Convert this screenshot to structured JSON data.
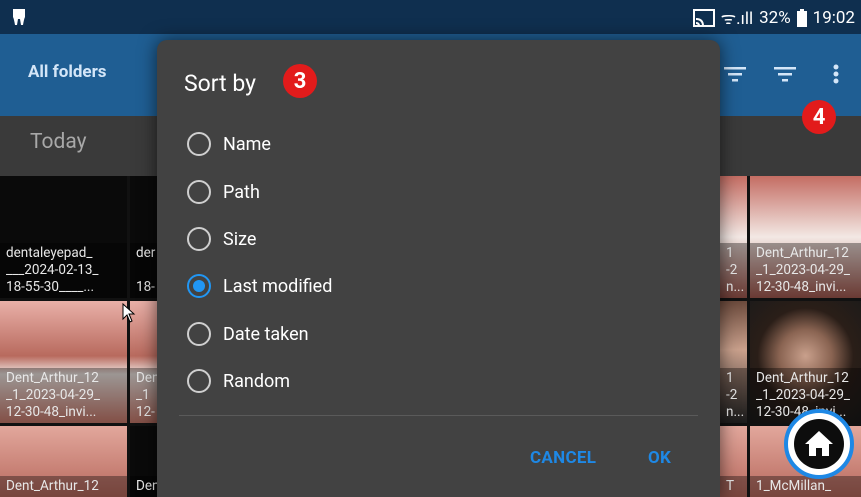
{
  "status": {
    "signal": "ᯤ.ıll",
    "battery": "32%",
    "time": "19:02"
  },
  "appbar": {
    "title": "All folders"
  },
  "subheader": {
    "label": "Today"
  },
  "tiles": [
    {
      "caption": "dentaleyepad_\n___2024-02-13_\n18-55-30____..."
    },
    {
      "caption": "der\n\n18-"
    },
    {
      "caption": "Dent_Arthur_12\n_1_2023-04-29_\n12-30-48_invi..."
    },
    {
      "caption": "Den\n_1\n12-"
    },
    {
      "caption": "1\n-2\nn..."
    },
    {
      "caption": "Dent_Arthur_12\n_1_2023-04-29_\n12-30-48_invi..."
    },
    {
      "caption": "1\n-2\nn..."
    },
    {
      "caption": "Dent_Arthur_12\n_1_2023-04-29_\n12-30-48_invi..."
    },
    {
      "caption": "Dent_Arthur_12"
    },
    {
      "caption": "Den"
    },
    {
      "caption": "T"
    },
    {
      "caption": "1_McMillan_"
    }
  ],
  "badges": {
    "dialog": "3",
    "menu": "4"
  },
  "dialog": {
    "title": "Sort by",
    "options": [
      {
        "label": "Name",
        "selected": false
      },
      {
        "label": "Path",
        "selected": false
      },
      {
        "label": "Size",
        "selected": false
      },
      {
        "label": "Last modified",
        "selected": true
      },
      {
        "label": "Date taken",
        "selected": false
      },
      {
        "label": "Random",
        "selected": false
      }
    ],
    "cancel": "CANCEL",
    "ok": "OK"
  },
  "colors": {
    "accent": "#1e88e5",
    "appbar": "#1f5e93",
    "badge": "#e21b1b"
  },
  "icons": [
    "tooth-icon",
    "cast-icon",
    "wifi-icon",
    "battery-icon",
    "filter-icon",
    "sort-icon",
    "more-vert-icon",
    "home-icon",
    "cursor-icon"
  ]
}
